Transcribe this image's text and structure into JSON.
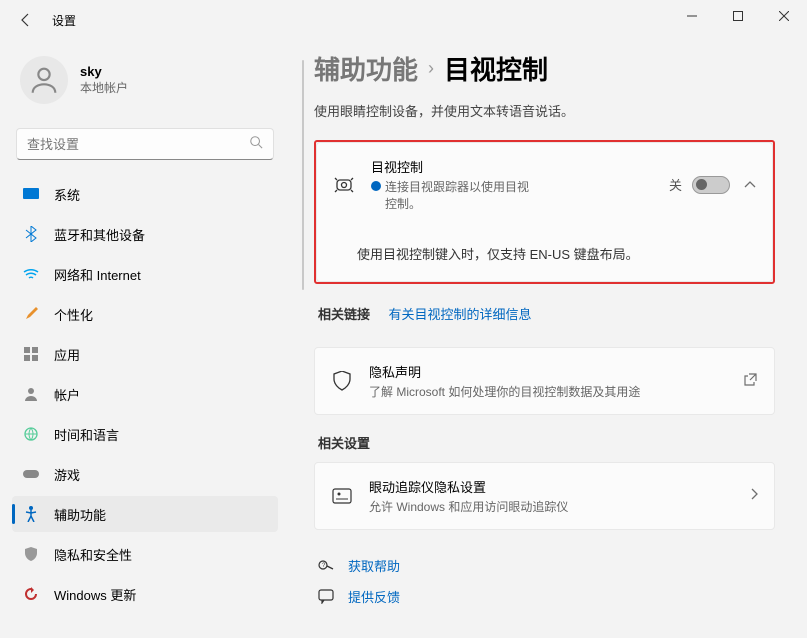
{
  "window": {
    "title": "设置"
  },
  "user": {
    "name": "sky",
    "subtitle": "本地帐户"
  },
  "search": {
    "placeholder": "查找设置"
  },
  "nav": {
    "items": [
      {
        "label": "系统",
        "color": "#0078d4"
      },
      {
        "label": "蓝牙和其他设备",
        "color": "#0078d4"
      },
      {
        "label": "网络和 Internet",
        "color": "#00a4ef"
      },
      {
        "label": "个性化",
        "color": "#e8912d"
      },
      {
        "label": "应用",
        "color": "#777"
      },
      {
        "label": "帐户",
        "color": "#777"
      },
      {
        "label": "时间和语言",
        "color": "#777"
      },
      {
        "label": "游戏",
        "color": "#777"
      },
      {
        "label": "辅助功能",
        "color": "#0067c0"
      },
      {
        "label": "隐私和安全性",
        "color": "#888"
      },
      {
        "label": "Windows 更新",
        "color": "#c03030"
      }
    ]
  },
  "breadcrumb": {
    "parent": "辅助功能",
    "current": "目视控制"
  },
  "description": "使用眼睛控制设备，并使用文本转语音说话。",
  "eyeControl": {
    "title": "目视控制",
    "subtitle": "连接目视跟踪器以使用目视控制。",
    "stateLabel": "关",
    "note": "使用目视控制键入时，仅支持 EN-US 键盘布局。"
  },
  "relatedLinks": {
    "title": "相关链接",
    "link": "有关目视控制的详细信息"
  },
  "privacy": {
    "title": "隐私声明",
    "subtitle": "了解 Microsoft 如何处理你的目视控制数据及其用途"
  },
  "relatedSettings": {
    "title": "相关设置",
    "item": {
      "title": "眼动追踪仪隐私设置",
      "subtitle": "允许 Windows 和应用访问眼动追踪仪"
    }
  },
  "footer": {
    "help": "获取帮助",
    "feedback": "提供反馈"
  }
}
